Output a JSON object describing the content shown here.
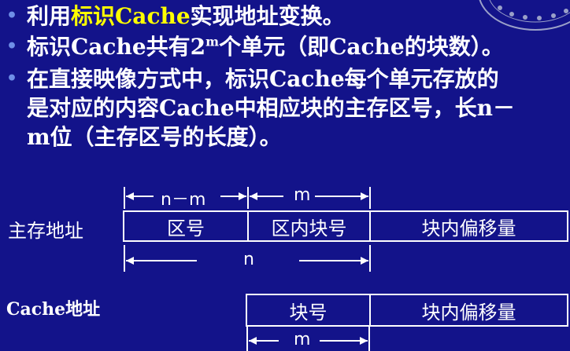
{
  "bullets": [
    {
      "prefix": "利用",
      "highlight": "标识Cache",
      "suffix": "实现地址变换。"
    },
    {
      "text_before": "标识Cache共有2",
      "sup": "m",
      "text_after": "个单元（即Cache的块数）。"
    },
    {
      "line1": "在直接映像方式中，标识Cache每个单元存放的",
      "line2": "是对应的内容Cache中相应块的主存区号，长n－",
      "line3": "m位（主存区号的长度）。"
    }
  ],
  "main_memory": {
    "label": "主存地址",
    "fields": [
      "区号",
      "区内块号",
      "块内偏移量"
    ],
    "dims": {
      "zone": "n－m",
      "block": "m",
      "total": "n"
    }
  },
  "cache": {
    "label": "Cache地址",
    "fields": [
      "块号",
      "块内偏移量"
    ],
    "dims": {
      "block": "m"
    }
  },
  "colors": {
    "background": "#13138a",
    "text": "#ffffff",
    "highlight": "#ffff00",
    "bullet": "#6f8fe8"
  }
}
